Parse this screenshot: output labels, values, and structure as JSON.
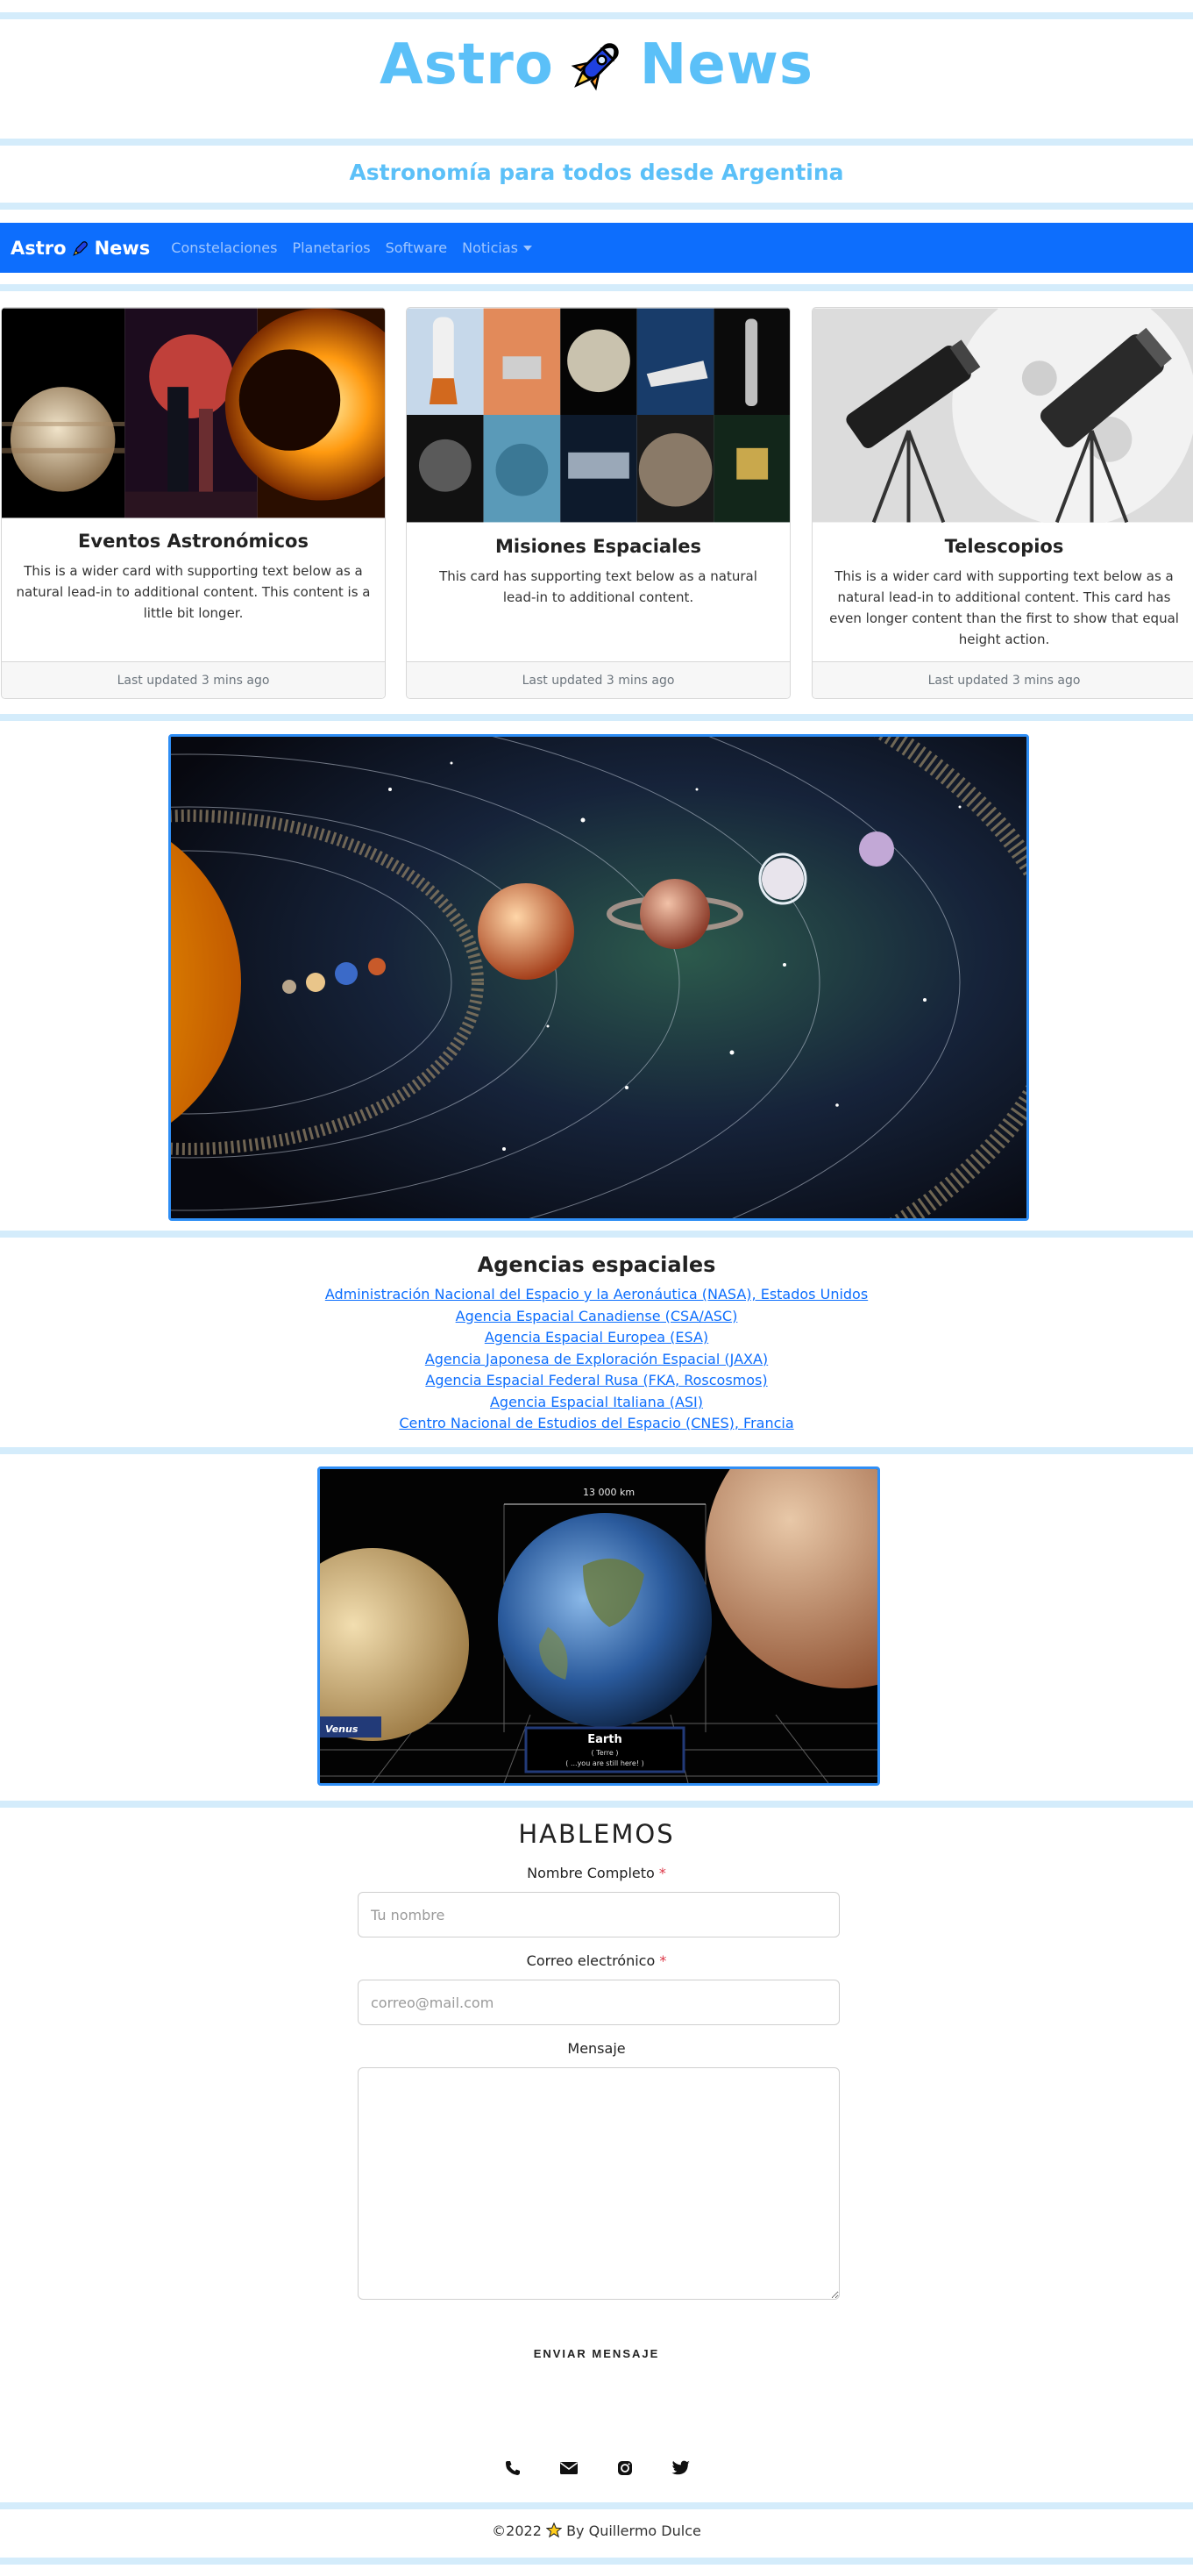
{
  "header": {
    "brand_left": "Astro",
    "brand_right": "News",
    "tagline": "Astronomía para todos desde Argentina"
  },
  "navbar": {
    "brand_left": "Astro",
    "brand_right": "News",
    "links": [
      "Constelaciones",
      "Planetarios",
      "Software",
      "Noticias"
    ]
  },
  "cards": [
    {
      "title": "Eventos Astronómicos",
      "text": "This is a wider card with supporting text below as a natural lead-in to additional content. This content is a little bit longer.",
      "footer": "Last updated 3 mins ago",
      "image": "eclipse-moon-jupiter-collage"
    },
    {
      "title": "Misiones Espaciales",
      "text": "This card has supporting text below as a natural lead-in to additional content.",
      "footer": "Last updated 3 mins ago",
      "image": "space-missions-grid"
    },
    {
      "title": "Telescopios",
      "text": "This is a wider card with supporting text below as a natural lead-in to additional content. This card has even longer content than the first to show that equal height action.",
      "footer": "Last updated 3 mins ago",
      "image": "telescopes-moon"
    }
  ],
  "solar_system_image": "solar-system-illustration",
  "agencies": {
    "title": "Agencias espaciales",
    "links": [
      "Administración Nacional del Espacio y la Aeronáutica (NASA), Estados Unidos",
      "Agencia Espacial Canadiense (CSA/ASC)",
      "Agencia Espacial Europea (ESA)",
      "Agencia Japonesa de Exploración Espacial (JAXA)",
      "Agencia Espacial Federal Rusa (FKA, Roscosmos)",
      "Agencia Espacial Italiana (ASI)",
      "Centro Nacional de Estudios del Espacio (CNES), Francia"
    ]
  },
  "planet_comparison": {
    "measure": "13 000 km",
    "left_label": "Venus",
    "center_label": "Earth",
    "center_sub1": "( Terre )",
    "center_sub2": "( ...you are still here! )"
  },
  "contact": {
    "title": "HABLEMOS",
    "name_label": "Nombre Completo",
    "name_placeholder": "Tu nombre",
    "email_label": "Correo electrónico",
    "email_placeholder": "correo@mail.com",
    "message_label": "Mensaje",
    "required_mark": "*",
    "submit_label": "ENVIAR MENSAJE"
  },
  "socials": [
    "phone-icon",
    "mail-icon",
    "instagram-icon",
    "twitter-icon"
  ],
  "footer": {
    "prefix": "©2022",
    "suffix": "By Quillermo Dulce"
  },
  "colors": {
    "brand": "#5bc0f8",
    "navbar": "#0d6efd",
    "separator": "#d4ecfb",
    "link": "#0d6efd",
    "frame": "#2f8ef5"
  }
}
